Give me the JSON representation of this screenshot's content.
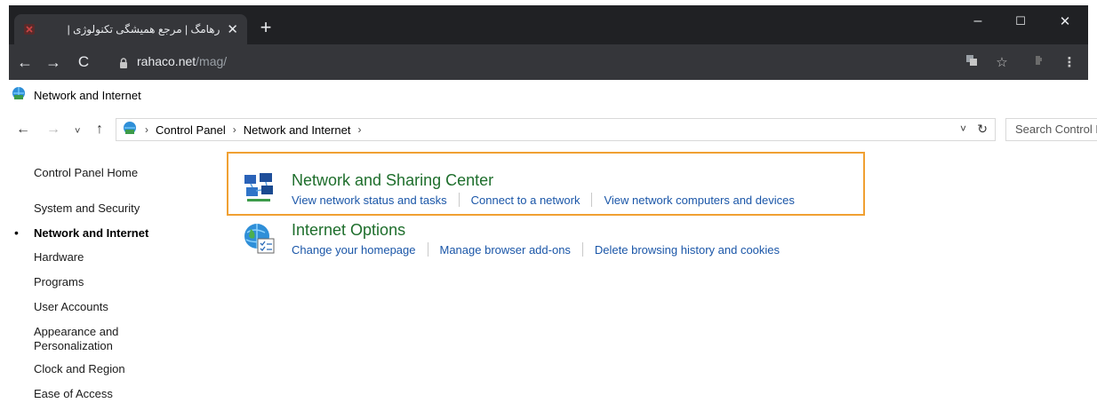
{
  "browser": {
    "tab_title": "رهامگ | مرجع همیشگی تکنولوژی |",
    "tab_close": "✕",
    "new_tab": "+",
    "url_domain": "rahaco.net",
    "url_path": "/mag/",
    "window_controls": {
      "minimize": "–",
      "maximize": "☐",
      "close": "✕"
    }
  },
  "window": {
    "title": "Network and Internet",
    "breadcrumb": [
      "Control Panel",
      "Network and Internet"
    ],
    "search_placeholder": "Search Control Panel"
  },
  "sidebar": {
    "items": [
      {
        "label": "Control Panel Home"
      },
      {
        "label": "System and Security"
      },
      {
        "label": "Network and Internet",
        "active": true
      },
      {
        "label": "Hardware"
      },
      {
        "label": "Programs"
      },
      {
        "label": "User Accounts"
      },
      {
        "label": "Appearance and\nPersonalization"
      },
      {
        "label": "Clock and Region"
      },
      {
        "label": "Ease of Access"
      }
    ]
  },
  "categories": [
    {
      "title": "Network and Sharing Center",
      "icon": "network-sharing-icon",
      "links": [
        "View network status and tasks",
        "Connect to a network",
        "View network computers and devices"
      ]
    },
    {
      "title": "Internet Options",
      "icon": "internet-options-icon",
      "links": [
        "Change your homepage",
        "Manage browser add-ons",
        "Delete browsing history and cookies"
      ]
    }
  ],
  "colors": {
    "highlight": "#f0a032",
    "category_title": "#1e6e2c",
    "link": "#1a56a8",
    "chrome_dark": "#202124"
  }
}
